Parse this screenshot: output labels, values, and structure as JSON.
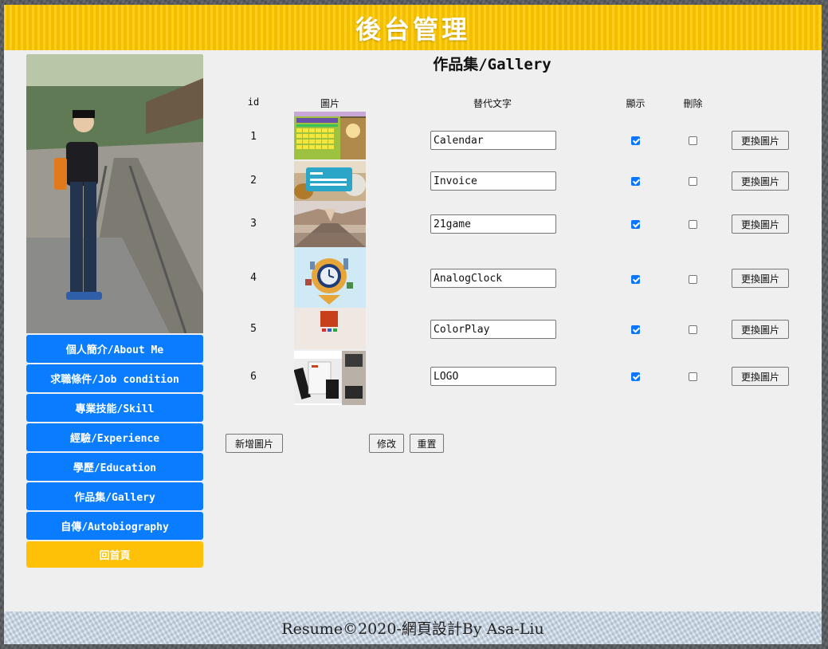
{
  "header": {
    "title": "後台管理"
  },
  "sidebar": {
    "menu": [
      {
        "label": "個人簡介/About Me"
      },
      {
        "label": "求職條件/Job condition"
      },
      {
        "label": "專業技能/Skill"
      },
      {
        "label": "經驗/Experience"
      },
      {
        "label": "學歷/Education"
      },
      {
        "label": "作品集/Gallery"
      },
      {
        "label": "自傳/Autobiography"
      },
      {
        "label": "回首頁"
      }
    ]
  },
  "main": {
    "title": "作品集/Gallery",
    "columns": {
      "id": "id",
      "image": "圖片",
      "alt": "替代文字",
      "show": "顯示",
      "delete": "刪除"
    },
    "rows": [
      {
        "id": "1",
        "alt": "Calendar",
        "show": true,
        "delete": false,
        "replace_label": "更換圖片"
      },
      {
        "id": "2",
        "alt": "Invoice",
        "show": true,
        "delete": false,
        "replace_label": "更換圖片"
      },
      {
        "id": "3",
        "alt": "21game",
        "show": true,
        "delete": false,
        "replace_label": "更換圖片"
      },
      {
        "id": "4",
        "alt": "AnalogClock",
        "show": true,
        "delete": false,
        "replace_label": "更換圖片"
      },
      {
        "id": "5",
        "alt": "ColorPlay",
        "show": true,
        "delete": false,
        "replace_label": "更換圖片"
      },
      {
        "id": "6",
        "alt": "LOGO",
        "show": true,
        "delete": false,
        "replace_label": "更換圖片"
      }
    ],
    "buttons": {
      "add": "新增圖片",
      "update": "修改",
      "reset": "重置"
    }
  },
  "footer": {
    "text": "Resume©2020-網頁設計By Asa-Liu"
  }
}
